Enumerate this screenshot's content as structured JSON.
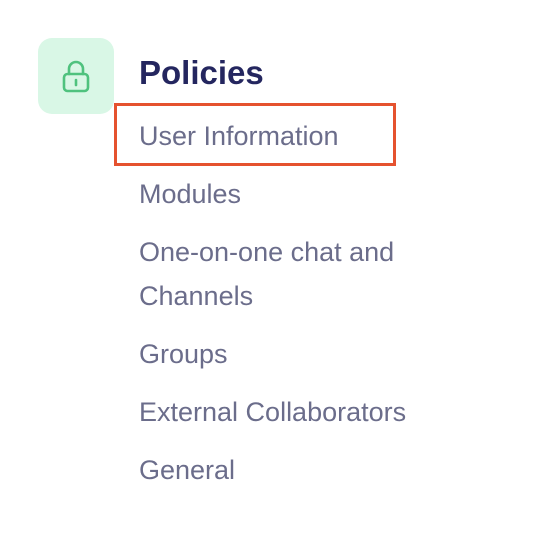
{
  "policies": {
    "icon": "lock-icon",
    "title": "Policies",
    "items": [
      {
        "label": "User Information"
      },
      {
        "label": "Modules"
      },
      {
        "label": "One-on-one chat and Channels"
      },
      {
        "label": "Groups"
      },
      {
        "label": "External Collaborators"
      },
      {
        "label": "General"
      }
    ],
    "highlighted_item": "User Information"
  },
  "colors": {
    "icon_tile_bg": "#d9f7e6",
    "icon_color": "#4fc27e",
    "title": "#24265f",
    "item_text": "#6b6d8b",
    "highlight_border": "#e5522f"
  }
}
